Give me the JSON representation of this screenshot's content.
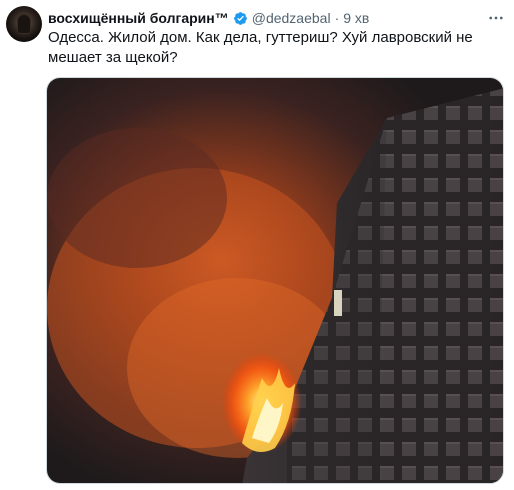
{
  "tweet": {
    "author_name": "восхищённый болгарин™",
    "handle": "@dedzaebal",
    "separator": "·",
    "time": "9 хв",
    "text": "Одесса. Жилой дом. Как дела, гуттериш? Хуй лавровский не мешает за щекой?",
    "verified_color": "#1d9bf0",
    "icons": {
      "verified": "verified-badge-icon",
      "more": "more-options-icon"
    },
    "media": {
      "description_icon": "photo"
    }
  }
}
